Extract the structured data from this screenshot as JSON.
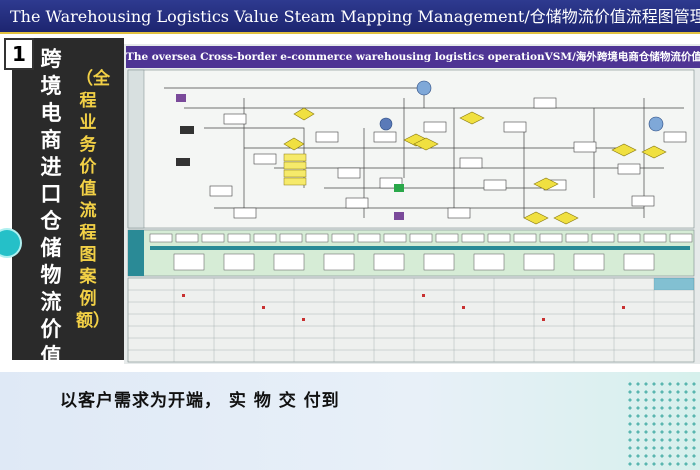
{
  "header": {
    "title": "The Warehousing Logistics Value Steam Mapping Management/仓储物流价值流程图管理"
  },
  "section": {
    "number": "1",
    "title": "跨境电商进口仓储物流价值流程",
    "subtitle": "（全程业务价值流程图案例额）"
  },
  "slide": {
    "title": "The oversea Cross-border e-commerce warehousing logistics operationVSM/海外跨境电商仓储物流价值流程图"
  },
  "footer": {
    "caption": "以客户需求为开端， 实 物 交 付到"
  },
  "colors": {
    "title_bg": "#24307e",
    "slide_header": "#4e3494",
    "accent_yellow": "#f2d046",
    "circle": "#25c0c8"
  }
}
